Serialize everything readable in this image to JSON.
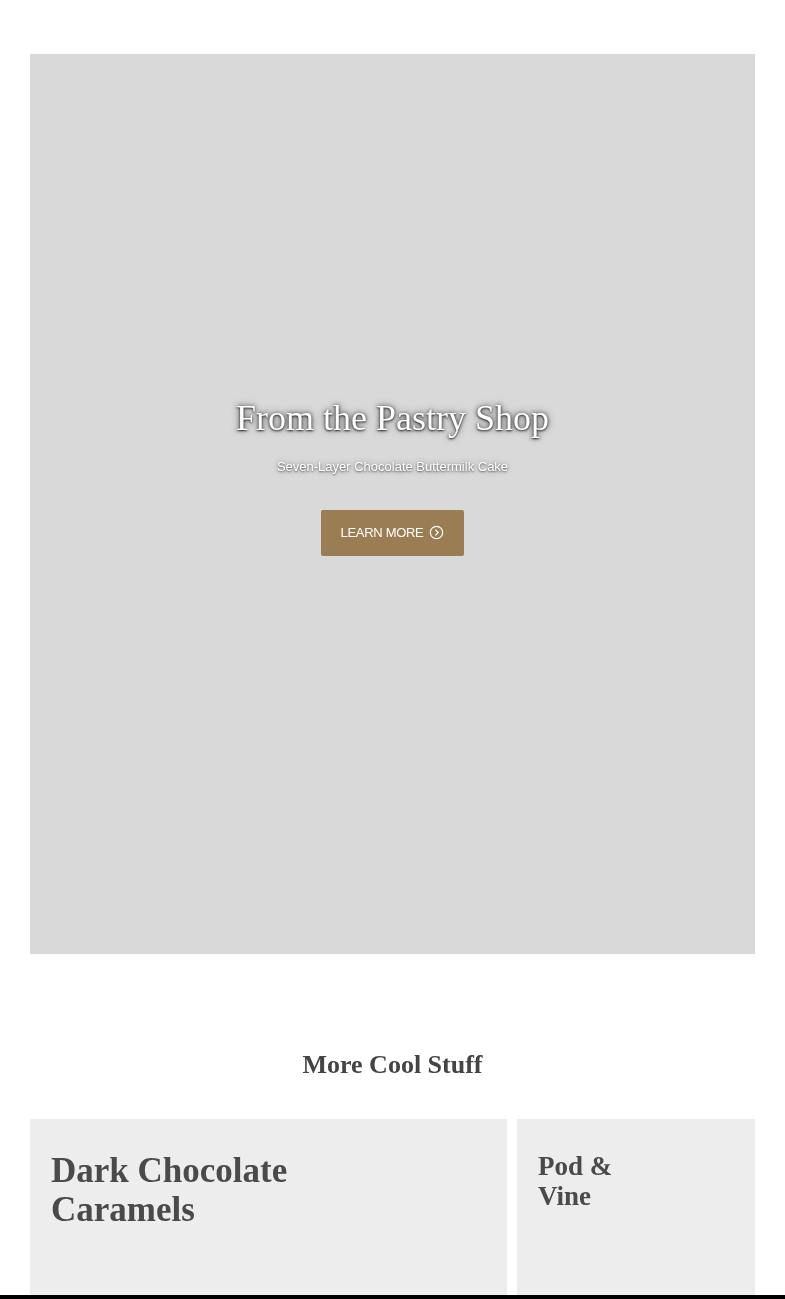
{
  "hero": {
    "title": "From the Pastry Shop",
    "subtitle": "Seven-Layer Chocolate Buttermilk Cake",
    "button": "LEARN MORE"
  },
  "section": {
    "title": "More Cool Stuff",
    "cards": [
      {
        "title": "Dark Chocolate Caramels",
        "kind": "wide"
      },
      {
        "title": "Pod & Vine",
        "kind": "narrow"
      }
    ]
  }
}
